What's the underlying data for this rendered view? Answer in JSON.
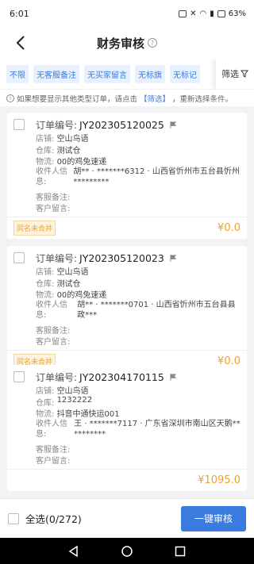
{
  "status": {
    "time": "6:01",
    "battery": "63%"
  },
  "header": {
    "title": "财务审核"
  },
  "filters": {
    "chips": [
      "不限",
      "无客服备注",
      "无买家留言",
      "无标旗",
      "无标记"
    ],
    "button_label": "筛选"
  },
  "hint": {
    "before": "如果想要显示其他类型订单，请点击",
    "link": "【筛选】",
    "after": "，重新选择条件。"
  },
  "labels": {
    "order_no": "订单编号:",
    "shop": "店铺:",
    "warehouse": "仓库:",
    "logistics": "物流:",
    "receiver": "收件人信息:",
    "cs_note": "客服备注:",
    "buyer_msg": "客户留言:"
  },
  "orders": [
    {
      "order_no": "JY202305120025",
      "shop": "空山鸟语",
      "warehouse": "测试仓",
      "logistics": "00的鸡兔速递",
      "receiver": "胡** · *******6312 · 山西省忻州市五台县忻州*********",
      "cs_note": "",
      "buyer_msg": "",
      "tag": "同名未合并",
      "amount": "¥0.0"
    },
    {
      "order_no": "JY202305120023",
      "shop": "空山鸟语",
      "warehouse": "测试仓",
      "logistics": "00的鸡兔速递",
      "receiver": "胡** · *******0701 · 山西省忻州市五台县县政***",
      "cs_note": "",
      "buyer_msg": "",
      "tag": "同名未合并",
      "amount": "¥0.0"
    },
    {
      "order_no": "JY202304170115",
      "shop": "空山鸟语",
      "warehouse": "1232222",
      "logistics": "抖音中通快运001",
      "receiver": "王 · *******7117 · 广东省深圳市南山区天鹅**********",
      "cs_note": "",
      "buyer_msg": "",
      "tag": "",
      "amount": "¥1095.0"
    }
  ],
  "footer": {
    "select_all": "全选(0/272)",
    "action": "一键审核"
  },
  "colors": {
    "accent": "#3a7be0",
    "amount": "#f0a02a",
    "tag_bg": "#fff3dc"
  }
}
